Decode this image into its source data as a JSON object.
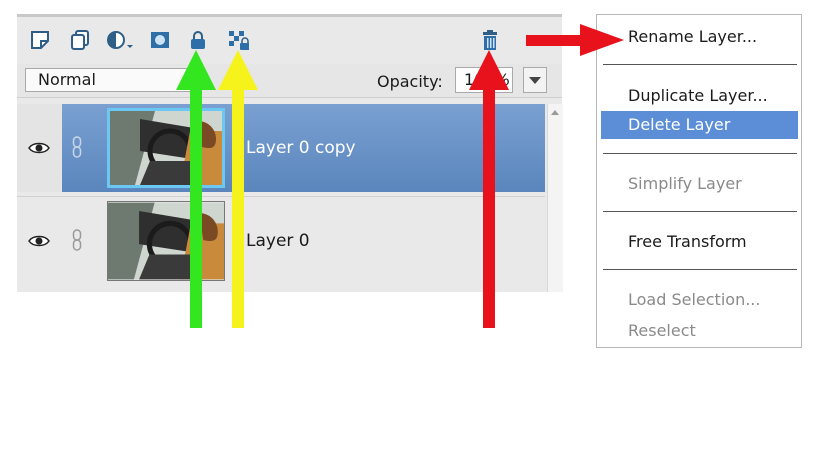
{
  "panel": {
    "toolbar_icons": [
      {
        "name": "new-layer-icon"
      },
      {
        "name": "duplicate-layer-icon"
      },
      {
        "name": "adjustment-layer-icon"
      },
      {
        "name": "layer-mask-icon"
      },
      {
        "name": "lock-all-icon"
      },
      {
        "name": "lock-transparency-icon"
      },
      {
        "name": "trash-icon"
      },
      {
        "name": "panel-menu-icon"
      }
    ],
    "blend_mode": "Normal",
    "opacity_label": "Opacity:",
    "opacity_value": "100%",
    "layers": [
      {
        "name": "Layer 0 copy",
        "selected": true
      },
      {
        "name": "Layer 0",
        "selected": false
      }
    ]
  },
  "menu": {
    "items": [
      {
        "label": "Rename Layer...",
        "state": "enabled"
      },
      {
        "label": "Duplicate Layer...",
        "state": "enabled"
      },
      {
        "label": "Delete Layer",
        "state": "highlighted"
      },
      {
        "label": "Simplify Layer",
        "state": "disabled"
      },
      {
        "label": "Free Transform",
        "state": "enabled"
      },
      {
        "label": "Load Selection...",
        "state": "disabled"
      },
      {
        "label": "Reselect",
        "state": "disabled"
      }
    ]
  },
  "colors": {
    "selection_blue": "#5b8ed6",
    "arrow_green": "#33e620",
    "arrow_yellow": "#f5f21c",
    "arrow_red": "#e8121c"
  }
}
